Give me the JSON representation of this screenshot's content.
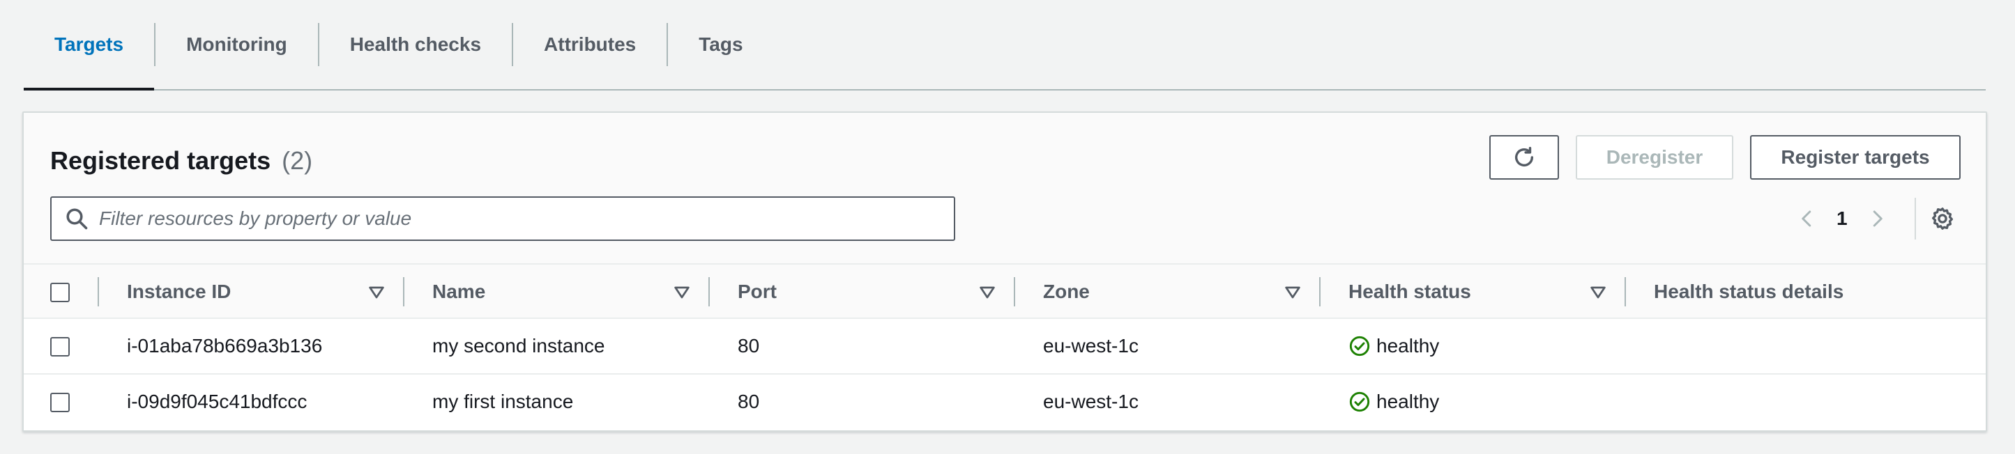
{
  "tabs": [
    {
      "label": "Targets",
      "active": true
    },
    {
      "label": "Monitoring",
      "active": false
    },
    {
      "label": "Health checks",
      "active": false
    },
    {
      "label": "Attributes",
      "active": false
    },
    {
      "label": "Tags",
      "active": false
    }
  ],
  "panel": {
    "title": "Registered targets",
    "count": "(2)",
    "deregister_label": "Deregister",
    "register_label": "Register targets",
    "refresh_icon": "refresh-icon"
  },
  "search": {
    "placeholder": "Filter resources by property or value",
    "value": ""
  },
  "pagination": {
    "current_page": "1"
  },
  "table": {
    "headers": {
      "instance_id": "Instance ID",
      "name": "Name",
      "port": "Port",
      "zone": "Zone",
      "health_status": "Health status",
      "health_status_details": "Health status details"
    },
    "rows": [
      {
        "instance_id": "i-01aba78b669a3b136",
        "name": "my second instance",
        "port": "80",
        "zone": "eu-west-1c",
        "health_status": "healthy",
        "health_status_details": ""
      },
      {
        "instance_id": "i-09d9f045c41bdfccc",
        "name": "my first instance",
        "port": "80",
        "zone": "eu-west-1c",
        "health_status": "healthy",
        "health_status_details": ""
      }
    ]
  },
  "colors": {
    "link": "#0073bb",
    "healthy": "#1d8102",
    "background": "#f2f3f3",
    "border": "#545b64"
  }
}
